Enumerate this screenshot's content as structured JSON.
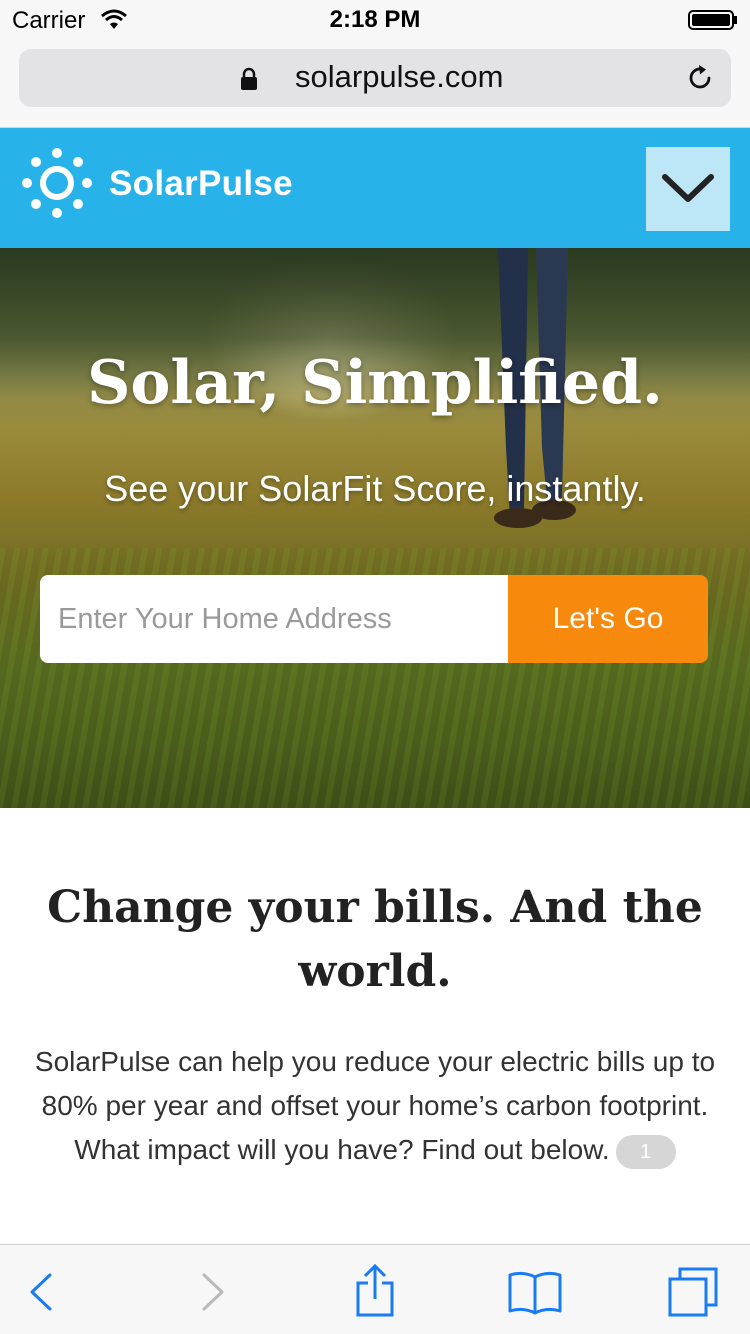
{
  "status_bar": {
    "carrier": "Carrier",
    "time": "2:18 PM",
    "icons": [
      "wifi-icon",
      "battery-icon"
    ]
  },
  "browser": {
    "url": "solarpulse.com",
    "icons": [
      "lock-icon",
      "reload-icon"
    ]
  },
  "header": {
    "brand": "SolarPulse",
    "logo_icon": "sun-icon",
    "menu_icon": "chevron-down-icon",
    "color": "#27b2ea"
  },
  "hero": {
    "title": "Solar, Simplified.",
    "subtitle": "See your SolarFit Score, instantly.",
    "address_placeholder": "Enter Your Home Address",
    "address_value": "",
    "cta_label": "Let's Go",
    "cta_color": "#f7890c"
  },
  "content": {
    "heading": "Change your bills. And the world.",
    "body": "SolarPulse can help you reduce your electric bills up to 80% per year and offset your home’s carbon footprint. What impact will you have? Find out below.",
    "badge": "1"
  },
  "toolbar": {
    "icons": [
      "back-icon",
      "forward-icon",
      "share-icon",
      "bookmarks-icon",
      "tabs-icon"
    ],
    "accent": "#1a7cf5"
  }
}
